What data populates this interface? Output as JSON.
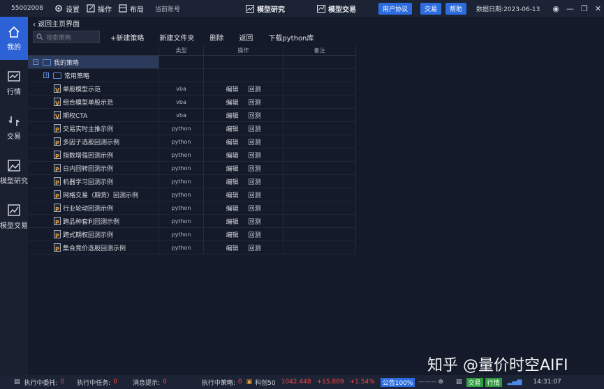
{
  "topbar": {
    "account_id": "55002008",
    "menu": [
      {
        "icon": "gear-icon",
        "label": "设置"
      },
      {
        "icon": "edit-icon",
        "label": "操作"
      },
      {
        "icon": "layout-icon",
        "label": "布局"
      }
    ],
    "current_account": "当前账号",
    "center_tabs": [
      {
        "icon": "chart-icon",
        "label": "模型研究"
      },
      {
        "icon": "trade-chart-icon",
        "label": "模型交易"
      }
    ],
    "buttons": [
      "用户协议",
      "交易",
      "帮助"
    ],
    "date": "数据日期:2023-06-13"
  },
  "sidebar": {
    "items": [
      {
        "icon": "home-icon",
        "label": "我的",
        "active": true
      },
      {
        "icon": "market-icon",
        "label": "行情",
        "active": false
      },
      {
        "icon": "exchange-icon",
        "label": "交易",
        "active": false
      },
      {
        "icon": "research-icon",
        "label": "模型研究",
        "active": false
      },
      {
        "icon": "model-trade-icon",
        "label": "模型交易",
        "active": false
      }
    ]
  },
  "main": {
    "back_label": "返回主页界面",
    "search_placeholder": "搜索策略",
    "actions": [
      "+新建策略",
      "新建文件夹",
      "删除",
      "返回",
      "下载python库"
    ],
    "columns": [
      "",
      "类型",
      "操作",
      "备注"
    ],
    "root_folder": "我的策略",
    "sub_folder": "常用策略",
    "op_edit": "编辑",
    "op_backtest": "回测",
    "rows": [
      {
        "name": "单股模型示范",
        "type": "vba",
        "badge": "V"
      },
      {
        "name": "组合模型单股示范",
        "type": "vba",
        "badge": "V"
      },
      {
        "name": "期权CTA",
        "type": "vba",
        "badge": "V"
      },
      {
        "name": "交易实时主推示例",
        "type": "python",
        "badge": "P"
      },
      {
        "name": "多因子选股回测示例",
        "type": "python",
        "badge": "P"
      },
      {
        "name": "指数增强回测示例",
        "type": "python",
        "badge": "P"
      },
      {
        "name": "日内回转回测示例",
        "type": "python",
        "badge": "P"
      },
      {
        "name": "机器学习回测示例",
        "type": "python",
        "badge": "P"
      },
      {
        "name": "网格交易（期货）回测示例",
        "type": "python",
        "badge": "P"
      },
      {
        "name": "行业轮动回测示例",
        "type": "python",
        "badge": "P"
      },
      {
        "name": "跨品种套利回测示例",
        "type": "python",
        "badge": "P"
      },
      {
        "name": "跨式期权回测示例",
        "type": "python",
        "badge": "P"
      },
      {
        "name": "集合竞价选股回测示例",
        "type": "python",
        "badge": "P"
      }
    ]
  },
  "statusbar": {
    "exec_orders_label": "执行中委托:",
    "exec_orders_value": "0",
    "exec_tasks_label": "执行中任务:",
    "exec_tasks_value": "0",
    "msg_label": "消息提示:",
    "msg_value": "0",
    "exec_strategy_label": "执行中策略:",
    "exec_strategy_value": "0",
    "index_name": "科创50",
    "index_value": "1042.448",
    "index_change": "+15.809",
    "index_pct": "+1.54%",
    "notice": "公告100%",
    "tags": [
      "交易",
      "行情"
    ],
    "time": "14:31:07"
  },
  "watermark": "知乎 @量价时空AIFI"
}
